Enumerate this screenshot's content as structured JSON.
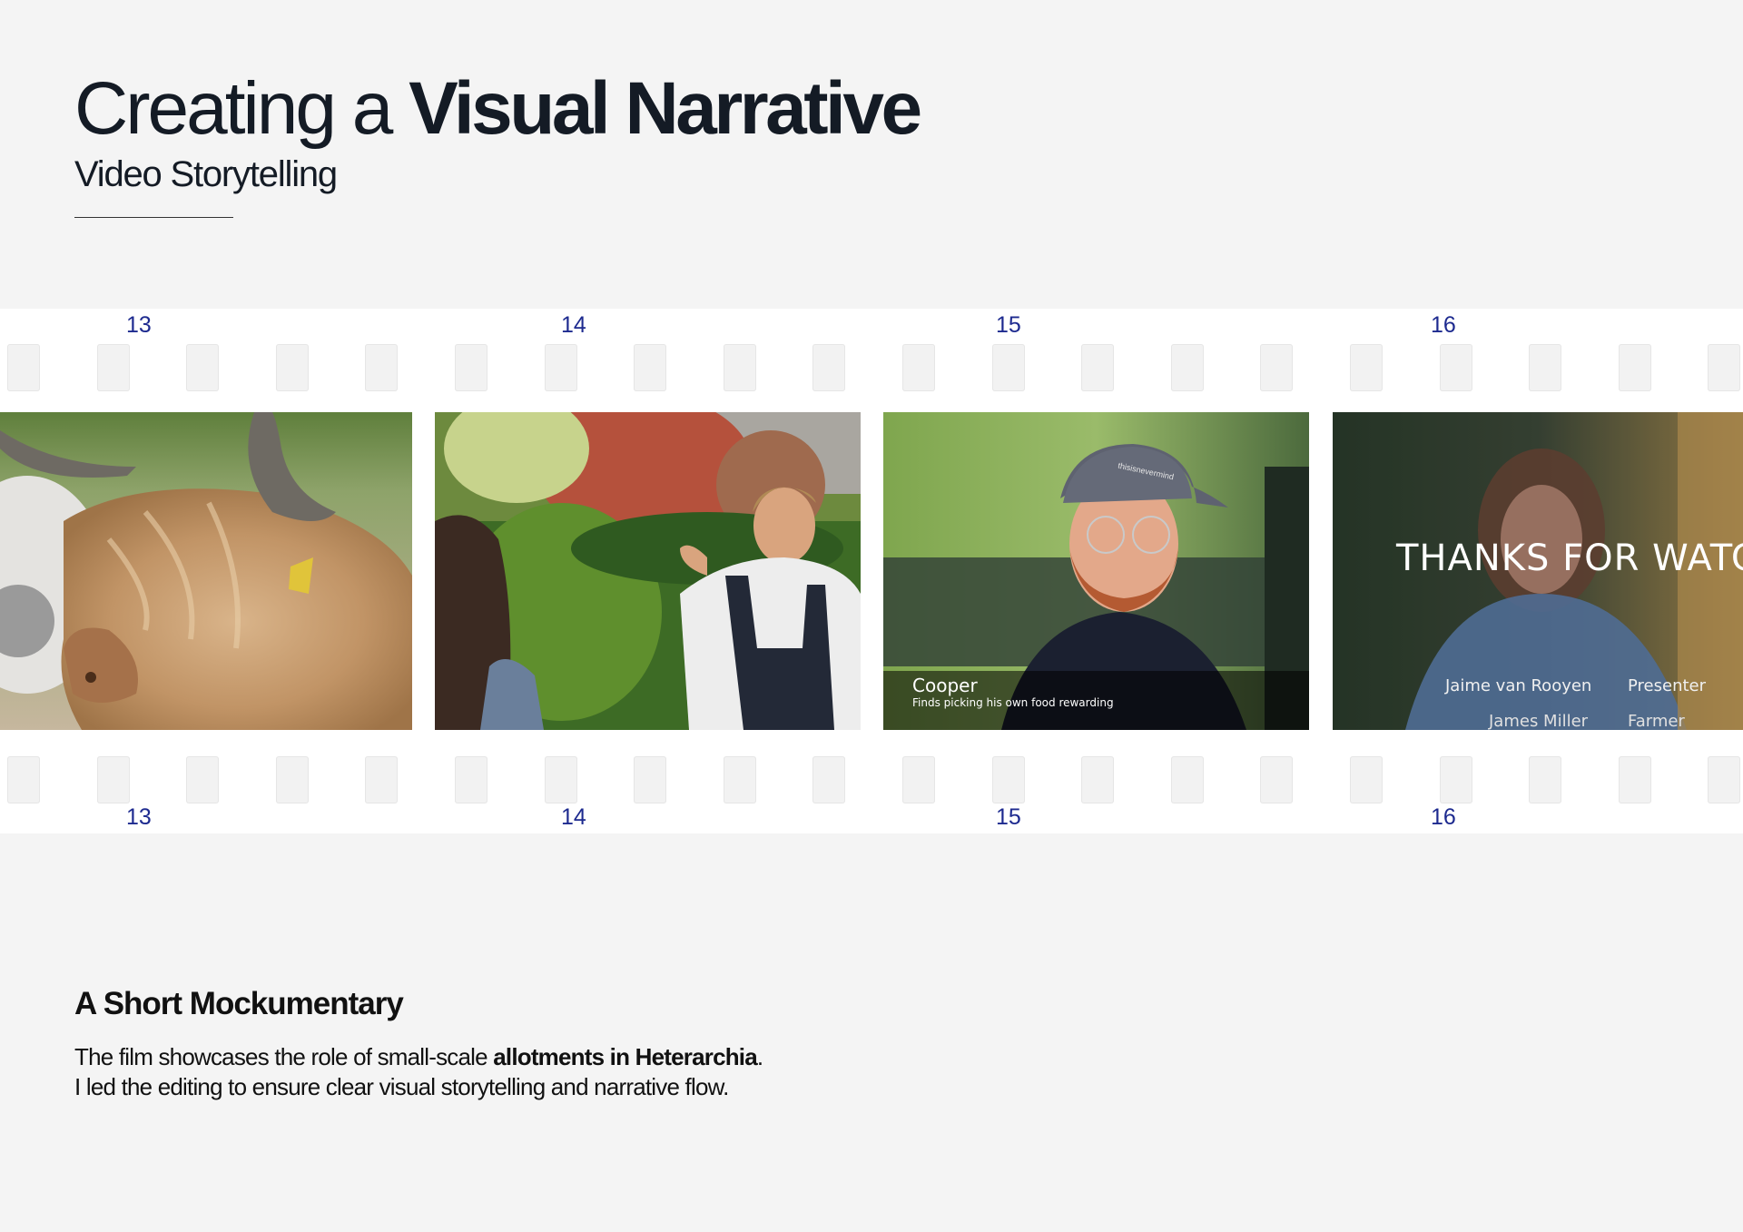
{
  "header": {
    "title_light": "Creating a",
    "title_bold": "Visual Narrative",
    "subtitle": "Video Storytelling"
  },
  "filmstrip": {
    "frame_numbers": [
      "13",
      "14",
      "15",
      "16"
    ],
    "frames": [
      {
        "id": 13,
        "image": "highland-cow-closeup"
      },
      {
        "id": 14,
        "image": "man-in-overalls-garden"
      },
      {
        "id": 15,
        "image": "interview-cooper",
        "caption_name": "Cooper",
        "caption_line": "Finds picking his own food rewarding",
        "cap_text": "thisisnevermind"
      },
      {
        "id": 16,
        "image": "end-credits",
        "overlay_title": "THANKS FOR WATCH",
        "credits": [
          {
            "name": "Jaime van Rooyen",
            "role": "Presenter"
          },
          {
            "name": "James Miller",
            "role": "Farmer"
          }
        ]
      }
    ]
  },
  "section": {
    "heading": "A Short Mockumentary",
    "para_line1_a": "The film showcases the role of small-scale ",
    "para_line1_bold": "allotments in Heterarchia",
    "para_line1_b": ".",
    "para_line2": "I led the editing to ensure clear visual storytelling and narrative flow."
  },
  "colors": {
    "background": "#f4f4f4",
    "frame_number": "#1d2a8f",
    "title": "#141b25"
  }
}
